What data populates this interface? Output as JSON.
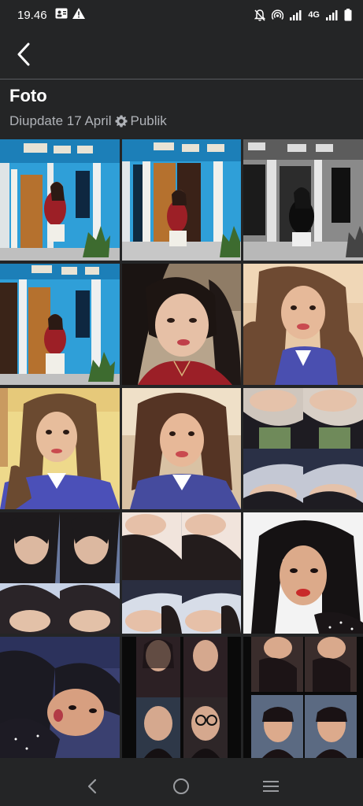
{
  "status_bar": {
    "time": "19.46",
    "network_label": "4G",
    "icons": [
      "contact-card-icon",
      "warning-icon",
      "mute-icon",
      "hotspot-icon",
      "signal-icon",
      "battery-icon"
    ]
  },
  "header": {
    "back_icon": "chevron-left-icon"
  },
  "album": {
    "title": "Foto",
    "updated_text": "Diupdate 17 April",
    "privacy_icon": "gear-icon",
    "privacy_label": "Publik"
  },
  "photos": [
    {
      "id": 1,
      "scene": "girl in red top standing at blue house"
    },
    {
      "id": 2,
      "scene": "girl in red top at blue house doorway"
    },
    {
      "id": 3,
      "scene": "black and white girl at house doorway"
    },
    {
      "id": 4,
      "scene": "girl in red top at blue house door"
    },
    {
      "id": 5,
      "scene": "selfie girl in red top"
    },
    {
      "id": 6,
      "scene": "selfie girl with curly hair in blue shirt"
    },
    {
      "id": 7,
      "scene": "girl with curly hair in blue shirt"
    },
    {
      "id": 8,
      "scene": "selfie girl in blue shirt"
    },
    {
      "id": 9,
      "scene": "collage of four selfies"
    },
    {
      "id": 10,
      "scene": "collage of four selfies"
    },
    {
      "id": 11,
      "scene": "collage of four selfies"
    },
    {
      "id": 12,
      "scene": "close up selfie with red lips"
    },
    {
      "id": 13,
      "scene": "selfie lying down"
    },
    {
      "id": 14,
      "scene": "collage of four portraits"
    },
    {
      "id": 15,
      "scene": "collage of four portraits"
    }
  ],
  "nav_bar": {
    "icons": [
      "back-icon",
      "home-icon",
      "recents-icon"
    ]
  },
  "colors": {
    "background": "#242526",
    "text_primary": "#ffffff",
    "text_secondary": "#b0b3b8"
  }
}
